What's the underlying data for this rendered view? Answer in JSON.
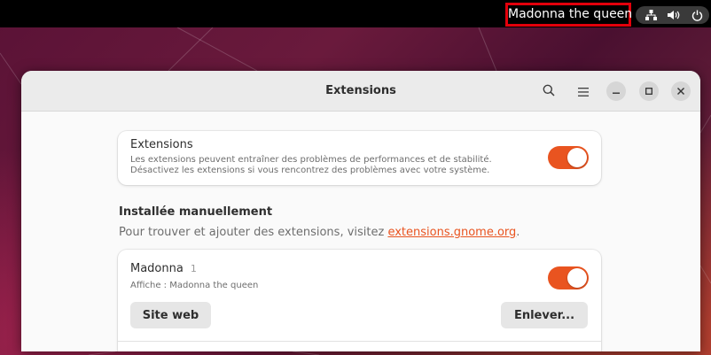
{
  "topbar": {
    "title": "Madonna the queen",
    "tray": [
      "network-icon",
      "volume-icon",
      "power-icon"
    ]
  },
  "window": {
    "title": "Extensions",
    "buttons": [
      "search-icon",
      "menu-icon",
      "minimize-icon",
      "maximize-icon",
      "close-icon"
    ]
  },
  "extensions_card": {
    "title": "Extensions",
    "line1": "Les extensions peuvent entraîner des problèmes de performances et de stabilité.",
    "line2": "Désactivez les extensions si vous rencontrez des problèmes avec votre système.",
    "enabled": true
  },
  "manual_section": {
    "title": "Installée manuellement",
    "desc_prefix": "Pour trouver et ajouter des extensions, visitez ",
    "link": "extensions.gnome.org",
    "desc_suffix": "."
  },
  "extension_item": {
    "name": "Madonna",
    "version": "1",
    "description": "Affiche : Madonna the queen",
    "enabled": true,
    "website_label": "Site web",
    "remove_label": "Enlever..."
  },
  "colors": {
    "accent": "#e95420",
    "highlight_border": "#e3000b"
  }
}
